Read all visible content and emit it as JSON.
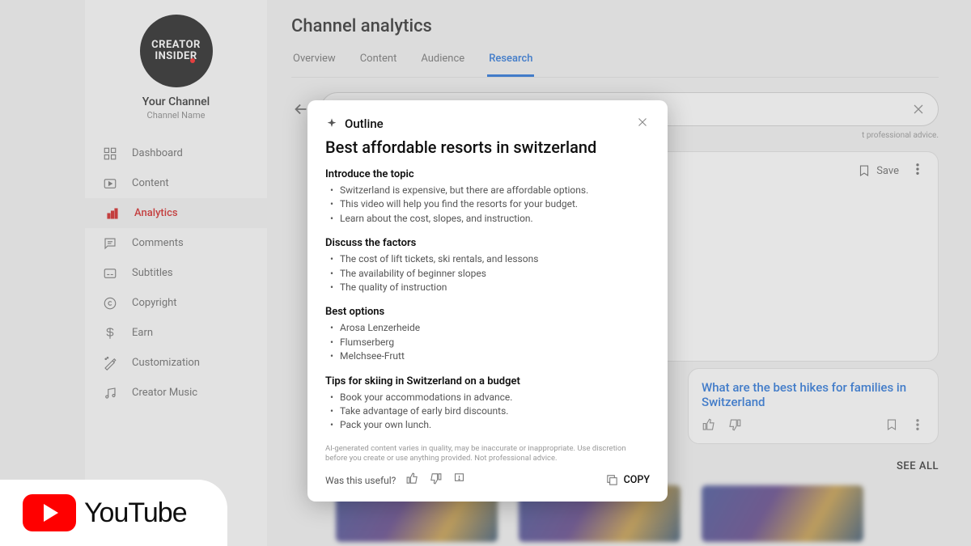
{
  "sidebar": {
    "avatar_line1": "CREATOR",
    "avatar_line2": "INSIDER",
    "your_channel": "Your Channel",
    "channel_name": "Channel Name",
    "items": [
      {
        "label": "Dashboard"
      },
      {
        "label": "Content"
      },
      {
        "label": "Analytics"
      },
      {
        "label": "Comments"
      },
      {
        "label": "Subtitles"
      },
      {
        "label": "Copyright"
      },
      {
        "label": "Earn"
      },
      {
        "label": "Customization"
      },
      {
        "label": "Creator Music"
      }
    ]
  },
  "main": {
    "title": "Channel analytics",
    "tabs": [
      "Overview",
      "Content",
      "Audience",
      "Research"
    ],
    "active_tab": "Research",
    "ai_note_suffix": "t professional advice.",
    "save_label": "Save",
    "see_all": "SEE ALL"
  },
  "suggestion": {
    "title": "What are the best hikes for families in Switzerland"
  },
  "modal": {
    "outline_label": "Outline",
    "title": "Best affordable resorts in switzerland",
    "sections": [
      {
        "heading": "Introduce the topic",
        "items": [
          "Switzerland is expensive, but there are affordable options.",
          "This video will help you find the resorts for your budget.",
          "Learn about the cost, slopes, and instruction."
        ]
      },
      {
        "heading": "Discuss the factors",
        "items": [
          "The cost of lift tickets, ski rentals, and lessons",
          "The availability of beginner slopes",
          "The quality of instruction"
        ]
      },
      {
        "heading": "Best options",
        "items": [
          "Arosa Lenzerheide",
          "Flumserberg",
          "Melchsee-Frutt"
        ]
      },
      {
        "heading": "Tips for skiing in Switzerland on a budget",
        "items": [
          "Book your accommodations in advance.",
          "Take advantage of early bird discounts.",
          "Pack your own lunch."
        ]
      }
    ],
    "disclaimer": "AI-generated content varies in quality, may be inaccurate or inappropriate. Use discretion before you create or use anything provided. Not professional advice.",
    "useful_q": "Was this useful?",
    "copy_label": "COPY"
  },
  "badge": {
    "text": "YouTube"
  }
}
